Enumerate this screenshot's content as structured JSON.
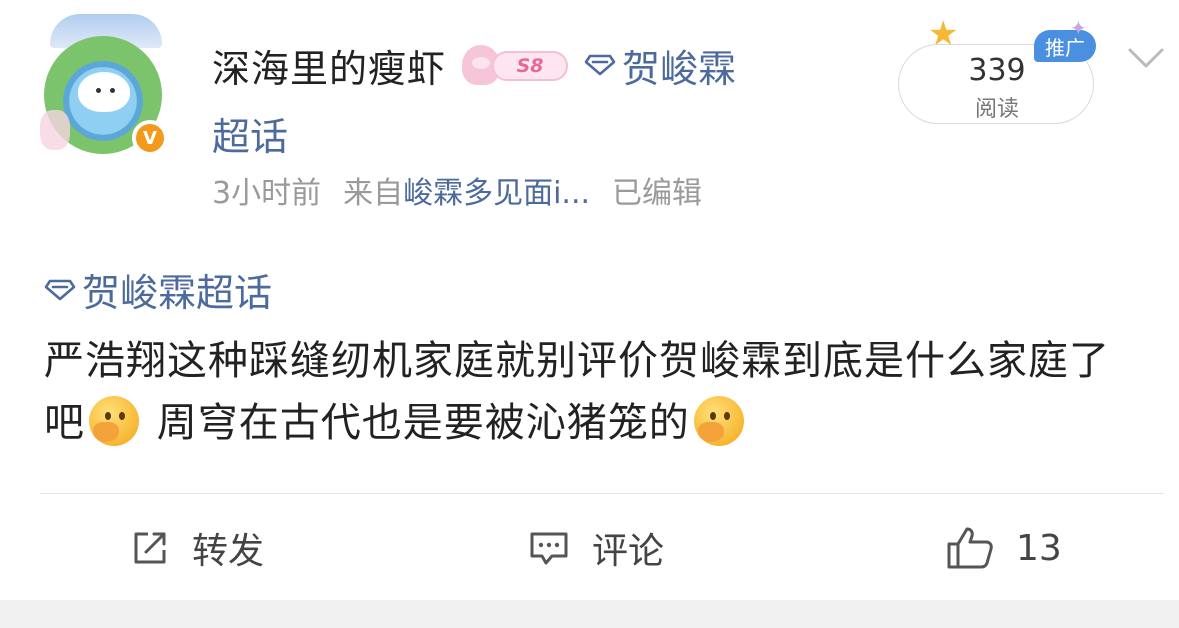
{
  "header": {
    "username": "深海里的瘦虾",
    "member_badge": "S8",
    "topic_inline": "贺峻霖",
    "topic_inline_cont": "超话",
    "time": "3小时前",
    "source_prefix": "来自",
    "source": "峻霖多见面i...",
    "edited": "已编辑",
    "verified_mark": "V"
  },
  "read_count": {
    "value": "339",
    "label": "阅读",
    "promo_label": "推广"
  },
  "post": {
    "topic_tag": "贺峻霖超话",
    "text_part1": "严浩翔这种踩缝纫机家庭就别评价贺峻霖到底是什么家庭了吧",
    "text_part2": "周穹在古代也是要被沁猪笼的"
  },
  "actions": {
    "repost_label": "转发",
    "comment_label": "评论",
    "like_count": "13"
  },
  "colors": {
    "link": "#4d6a9d",
    "meta": "#9a9a9a",
    "badge_orange": "#f39a1c",
    "promo_blue": "#4b8fe0"
  },
  "icons": {
    "verify": "verified-badge-icon",
    "topic": "diamond-icon",
    "repost": "repost-icon",
    "comment": "comment-icon",
    "like": "thumbs-up-icon",
    "more": "chevron-down-icon",
    "emoji": "face-with-hand-over-mouth-icon"
  }
}
